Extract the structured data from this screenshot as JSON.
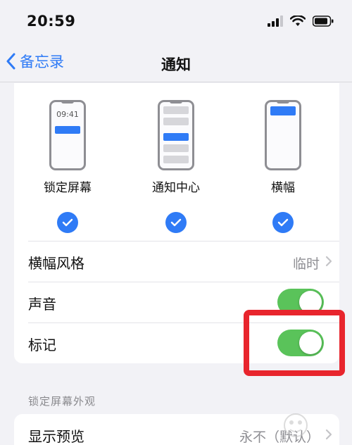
{
  "status_bar": {
    "time": "20:59"
  },
  "nav": {
    "back_label": "备忘录",
    "title": "通知"
  },
  "alert_styles": [
    {
      "label": "锁定屏幕",
      "checked": true,
      "preview_time": "09:41"
    },
    {
      "label": "通知中心",
      "checked": true
    },
    {
      "label": "横幅",
      "checked": true
    }
  ],
  "settings": {
    "banner_style": {
      "title": "横幅风格",
      "value": "临时"
    },
    "sound": {
      "title": "声音",
      "enabled": true
    },
    "badges": {
      "title": "标记",
      "enabled": true
    }
  },
  "lock_screen_section": {
    "header": "锁定屏幕外观",
    "show_previews": {
      "title": "显示预览",
      "value": "永不（默认）"
    }
  },
  "colors": {
    "accent": "#2f7bf6",
    "toggle_on": "#5ac35a",
    "highlight": "#e8252d"
  }
}
